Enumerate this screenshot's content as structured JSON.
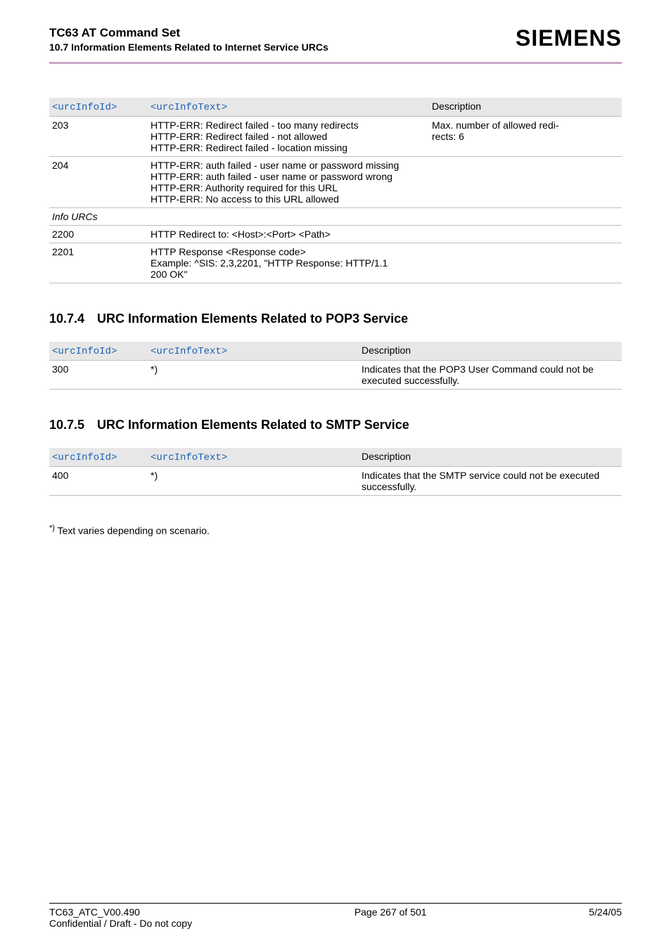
{
  "header": {
    "title": "TC63 AT Command Set",
    "subtitle": "10.7 Information Elements Related to Internet Service URCs",
    "brand": "SIEMENS"
  },
  "table1": {
    "head": {
      "c1": "<urcInfoId>",
      "c2": "<urcInfoText>",
      "c3": "Description"
    },
    "rows": [
      {
        "id": "203",
        "text": [
          "HTTP-ERR: Redirect failed - too many redirects",
          "HTTP-ERR: Redirect failed - not allowed",
          "HTTP-ERR: Redirect failed - location missing"
        ],
        "desc": [
          "Max. number of allowed redi-",
          "rects: 6"
        ]
      },
      {
        "id": "204",
        "text": [
          "HTTP-ERR: auth failed - user name or password missing",
          "HTTP-ERR: auth failed - user name or password wrong",
          "HTTP-ERR: Authority required for this URL",
          "HTTP-ERR: No access to this URL allowed"
        ],
        "desc": []
      },
      {
        "id": "Info URCs",
        "text": [],
        "desc": [],
        "italic": true
      },
      {
        "id": "2200",
        "text": [
          "HTTP Redirect to: <Host>:<Port> <Path>"
        ],
        "desc": []
      },
      {
        "id": "2201",
        "text": [
          "HTTP Response <Response code>",
          "Example: ^SIS: 2,3,2201, \"HTTP Response: HTTP/1.1",
          "200 OK\""
        ],
        "desc": []
      }
    ]
  },
  "section2": {
    "num": "10.7.4",
    "title": "URC Information Elements Related to POP3 Service"
  },
  "table2": {
    "head": {
      "c1": "<urcInfoId>",
      "c2": "<urcInfoText>",
      "c3": "Description"
    },
    "rows": [
      {
        "id": "300",
        "text": "*)",
        "desc": "Indicates that the POP3 User Command could not be executed successfully."
      }
    ]
  },
  "section3": {
    "num": "10.7.5",
    "title": "URC Information Elements Related to SMTP Service"
  },
  "table3": {
    "head": {
      "c1": "<urcInfoId>",
      "c2": "<urcInfoText>",
      "c3": "Description"
    },
    "rows": [
      {
        "id": "400",
        "text": "*)",
        "desc": "Indicates that the SMTP service could not be executed successfully."
      }
    ]
  },
  "footnote": "Text varies depending on scenario.",
  "footnote_mark": "*)",
  "footer": {
    "left1": "TC63_ATC_V00.490",
    "left2": "Confidential / Draft - Do not copy",
    "center": "Page 267 of 501",
    "right": "5/24/05"
  }
}
